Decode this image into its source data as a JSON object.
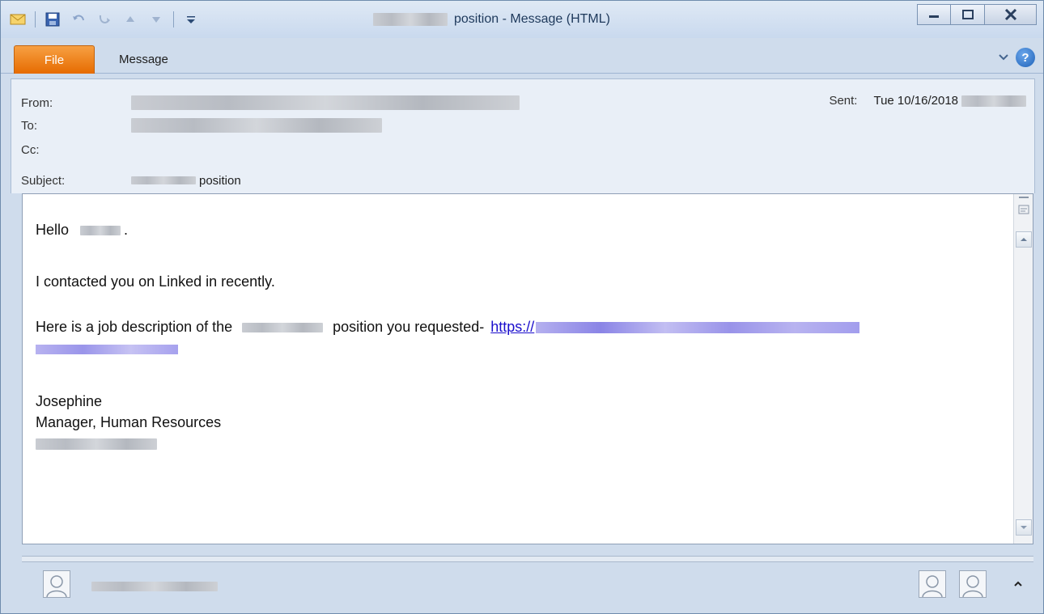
{
  "window": {
    "title_suffix": "position - Message (HTML)"
  },
  "ribbon": {
    "file_tab": "File",
    "message_tab": "Message",
    "help": "?"
  },
  "header": {
    "from_label": "From:",
    "to_label": "To:",
    "cc_label": "Cc:",
    "subject_label": "Subject:",
    "subject_suffix": "position",
    "sent_label": "Sent:",
    "sent_value": "Tue 10/16/2018"
  },
  "body": {
    "greeting": "Hello",
    "greeting_end": ".",
    "line1": "I contacted you on Linked in recently.",
    "line2_start": "Here is a job description of the",
    "line2_mid": "position you requested-",
    "link_text": "https://",
    "sig_name": "Josephine",
    "sig_title": "Manager, Human Resources"
  },
  "colors": {
    "file_tab": "#e66b00",
    "link": "#1a0dcc",
    "chrome": "#cfdcec"
  }
}
